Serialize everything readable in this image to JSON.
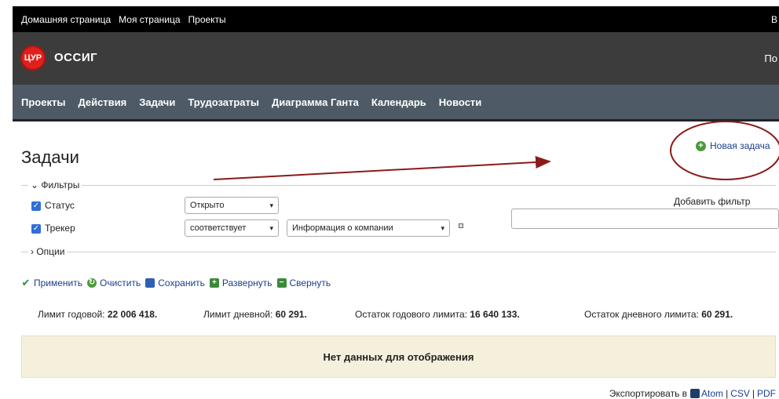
{
  "top_menu": {
    "items": [
      "Домашняя страница",
      "Моя страница",
      "Проекты"
    ],
    "right_partial": "В"
  },
  "header": {
    "logo_text": "ЦУР",
    "project_name": "ОССИГ",
    "right_partial": "По"
  },
  "main_menu": {
    "items": [
      "Проекты",
      "Действия",
      "Задачи",
      "Трудозатраты",
      "Диаграмма Ганта",
      "Календарь",
      "Новости"
    ],
    "selected": "Задачи"
  },
  "page": {
    "title": "Задачи",
    "new_issue": "Новая задача"
  },
  "filters": {
    "legend": "Фильтры",
    "rows": [
      {
        "label": "Статус",
        "operator": "Открыто",
        "value": ""
      },
      {
        "label": "Трекер",
        "operator": "соответствует",
        "value": "Информация о компании"
      }
    ],
    "add_filter_label": "Добавить фильтр"
  },
  "options": {
    "legend": "Опции"
  },
  "actions": {
    "apply": "Применить",
    "clear": "Очистить",
    "save": "Сохранить",
    "expand": "Развернуть",
    "collapse": "Свернуть"
  },
  "limits": {
    "annual_label": "Лимит годовой:",
    "annual_value": "22 006 418.",
    "daily_label": "Лимит дневной:",
    "daily_value": "60 291.",
    "annual_rest_label": "Остаток годового лимита:",
    "annual_rest_value": "16 640 133.",
    "daily_rest_label": "Остаток дневного лимита:",
    "daily_rest_value": "60 291."
  },
  "nodata": "Нет данных для отображения",
  "export": {
    "label": "Экспортировать в",
    "atom": "Atom",
    "csv": "CSV",
    "pdf": "PDF",
    "sep": "|"
  },
  "colors": {
    "top_menu_bg": "#000000",
    "header_bg": "#3c3c3c",
    "main_menu_bg": "#4e5b66",
    "link": "#1a3f8f",
    "annotation": "#8b1a1a",
    "nodata_bg": "#f5f0dc"
  }
}
